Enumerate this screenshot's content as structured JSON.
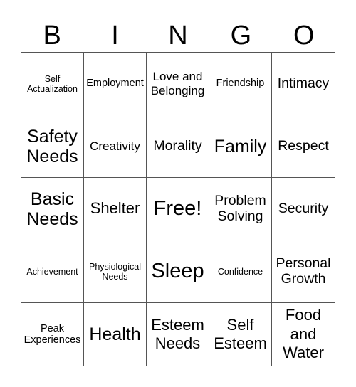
{
  "header": [
    "B",
    "I",
    "N",
    "G",
    "O"
  ],
  "cells": [
    "Self Actualization",
    "Employment",
    "Love and Belonging",
    "Friendship",
    "Intimacy",
    "Safety Needs",
    "Creativity",
    "Morality",
    "Family",
    "Respect",
    "Basic Needs",
    "Shelter",
    "Free!",
    "Problem Solving",
    "Security",
    "Achievement",
    "Physiological Needs",
    "Sleep",
    "Confidence",
    "Personal Growth",
    "Peak Experiences",
    "Health",
    "Esteem Needs",
    "Self Esteem",
    "Food and Water"
  ]
}
